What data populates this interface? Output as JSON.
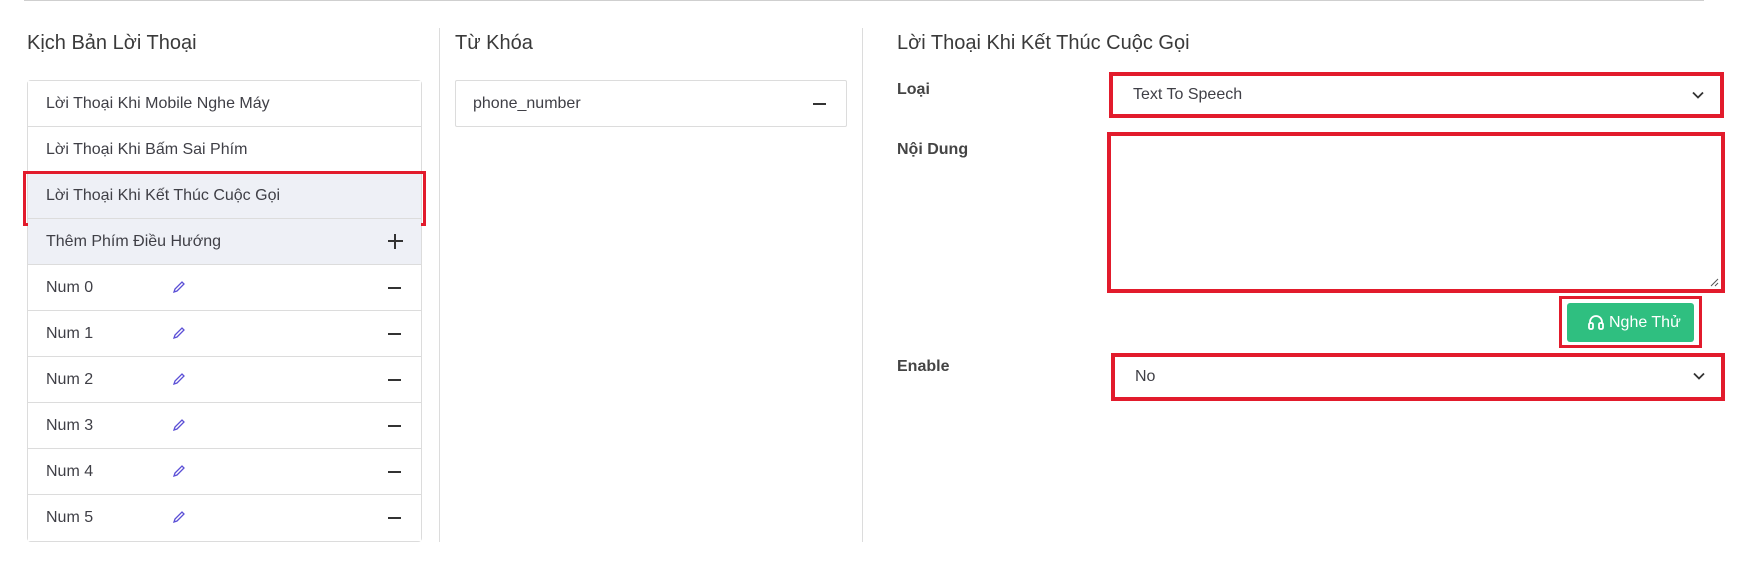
{
  "scripts_panel": {
    "title": "Kịch Bản Lời Thoại",
    "items": [
      {
        "label": "Lời Thoại Khi Mobile Nghe Máy"
      },
      {
        "label": "Lời Thoại Khi Bấm Sai Phím"
      },
      {
        "label": "Lời Thoại Khi Kết Thúc Cuộc Gọi"
      }
    ],
    "add_nav_label": "Thêm Phím Điều Hướng",
    "nums": [
      {
        "label": "Num 0"
      },
      {
        "label": "Num 1"
      },
      {
        "label": "Num 2"
      },
      {
        "label": "Num 3"
      },
      {
        "label": "Num 4"
      },
      {
        "label": "Num 5"
      }
    ]
  },
  "keywords_panel": {
    "title": "Từ Khóa",
    "items": [
      {
        "label": "phone_number"
      }
    ]
  },
  "detail_panel": {
    "title": "Lời Thoại Khi Kết Thúc Cuộc Gọi",
    "type_label": "Loại",
    "type_value": "Text To Speech",
    "content_label": "Nội Dung",
    "content_value": "",
    "listen_label": "Nghe Thử",
    "enable_label": "Enable",
    "enable_value": "No"
  },
  "colors": {
    "highlight": "#e21b2c",
    "listen_button": "#2fbf80",
    "edit_icon": "#5b4fd6",
    "active_row": "#eef0f6"
  },
  "icons": {
    "edit": "pencil-icon",
    "remove": "minus-icon",
    "add": "plus-icon",
    "dropdown": "chevron-down-icon",
    "listen": "headphones-icon"
  }
}
